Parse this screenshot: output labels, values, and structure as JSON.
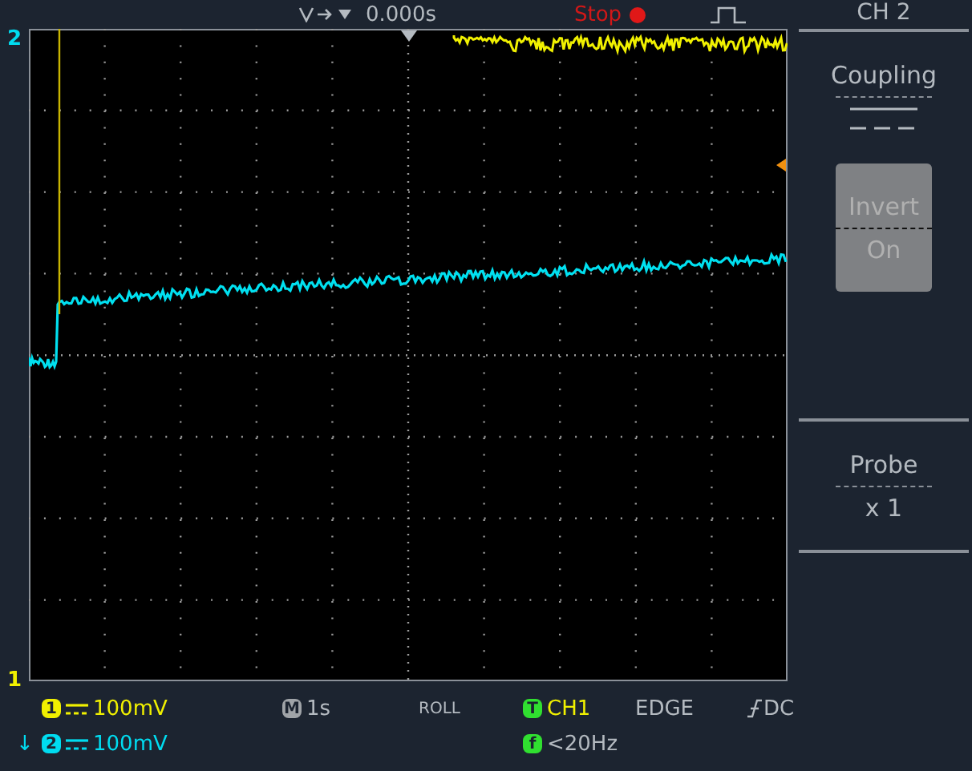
{
  "top_bar": {
    "trigger_position": "0.000s",
    "run_state": "Stop"
  },
  "channel_markers": [
    {
      "label": "2",
      "color": "#00dcf0"
    },
    {
      "label": "1",
      "color": "#f0f000"
    }
  ],
  "menu": {
    "title": "CH 2",
    "items": [
      {
        "kind": "coupling",
        "label": "Coupling"
      },
      {
        "kind": "toggle",
        "label": "Invert",
        "value": "On",
        "selected": true
      },
      {
        "kind": "blank"
      },
      {
        "kind": "option",
        "label": "Probe",
        "value": "x 1"
      },
      {
        "kind": "blank"
      }
    ]
  },
  "status": {
    "channels": [
      {
        "number": "1",
        "scale": "100mV",
        "color": "#f0f000"
      },
      {
        "prefix": "↓",
        "number": "2",
        "scale": "100mV",
        "color": "#00dcf0"
      }
    ],
    "timebase": {
      "badge": "M",
      "value": "1s",
      "mode": "ROLL"
    },
    "trigger": {
      "badge": "T",
      "source": "CH1",
      "type": "EDGE",
      "coupling": "DC"
    },
    "frequency": {
      "badge": "f",
      "value": "<20Hz"
    }
  }
}
